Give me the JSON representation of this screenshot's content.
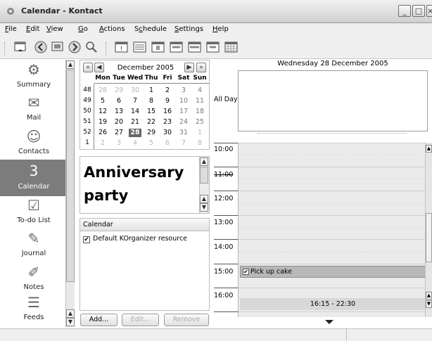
{
  "window": {
    "title": "Calendar - Kontact",
    "controls": [
      "_",
      "□",
      "×"
    ]
  },
  "menu": [
    {
      "pre": "",
      "u": "F",
      "post": "ile"
    },
    {
      "pre": "",
      "u": "E",
      "post": "dit"
    },
    {
      "pre": "",
      "u": "V",
      "post": "iew"
    },
    {
      "pre": "",
      "u": "G",
      "post": "o"
    },
    {
      "pre": "",
      "u": "A",
      "post": "ctions"
    },
    {
      "pre": "S",
      "u": "c",
      "post": "hedule"
    },
    {
      "pre": "",
      "u": "S",
      "post": "ettings"
    },
    {
      "pre": "",
      "u": "H",
      "post": "elp"
    }
  ],
  "toolbar": {
    "icons": [
      "new-icon",
      "back-icon",
      "forward-icon",
      "goto-icon",
      "find-icon",
      "today-icon",
      "list-icon",
      "day-icon",
      "workweek-icon",
      "week-icon",
      "nextdays-icon",
      "month-icon"
    ]
  },
  "sidebar": {
    "items": [
      {
        "label": "Summary",
        "icon": "summary-icon",
        "glyph": "⚙"
      },
      {
        "label": "Mail",
        "icon": "mail-icon",
        "glyph": "✉"
      },
      {
        "label": "Contacts",
        "icon": "contacts-icon",
        "glyph": "☺"
      },
      {
        "label": "Calendar",
        "icon": "calendar-icon",
        "glyph": "3",
        "selected": true
      },
      {
        "label": "To-do List",
        "icon": "todo-icon",
        "glyph": "☑"
      },
      {
        "label": "Journal",
        "icon": "journal-icon",
        "glyph": "✎"
      },
      {
        "label": "Notes",
        "icon": "notes-icon",
        "glyph": "✐"
      },
      {
        "label": "Feeds",
        "icon": "feeds-icon",
        "glyph": "☰"
      }
    ]
  },
  "navigator": {
    "month": "December 2005",
    "day_headers": [
      "Mon",
      "Tue",
      "Wed",
      "Thu",
      "Fri",
      "Sat",
      "Sun"
    ],
    "weeks": [
      {
        "wn": "48",
        "days": [
          [
            "28",
            "other"
          ],
          [
            "29",
            "other"
          ],
          [
            "30",
            "other"
          ],
          [
            "1",
            ""
          ],
          [
            "2",
            ""
          ],
          [
            "3",
            "wk"
          ],
          [
            "4",
            "wk"
          ]
        ]
      },
      {
        "wn": "49",
        "days": [
          [
            "5",
            ""
          ],
          [
            "6",
            ""
          ],
          [
            "7",
            ""
          ],
          [
            "8",
            ""
          ],
          [
            "9",
            ""
          ],
          [
            "10",
            "wk"
          ],
          [
            "11",
            "wk"
          ]
        ]
      },
      {
        "wn": "50",
        "days": [
          [
            "12",
            ""
          ],
          [
            "13",
            ""
          ],
          [
            "14",
            ""
          ],
          [
            "15",
            ""
          ],
          [
            "16",
            ""
          ],
          [
            "17",
            "wk"
          ],
          [
            "18",
            "wk"
          ]
        ]
      },
      {
        "wn": "51",
        "days": [
          [
            "19",
            ""
          ],
          [
            "20",
            ""
          ],
          [
            "21",
            ""
          ],
          [
            "22",
            ""
          ],
          [
            "23",
            ""
          ],
          [
            "24",
            "wk"
          ],
          [
            "25",
            "wk"
          ]
        ]
      },
      {
        "wn": "52",
        "days": [
          [
            "26",
            ""
          ],
          [
            "27",
            ""
          ],
          [
            "28",
            "today"
          ],
          [
            "29",
            ""
          ],
          [
            "30",
            ""
          ],
          [
            "31",
            "wk"
          ],
          [
            "1",
            "other"
          ]
        ]
      },
      {
        "wn": "1",
        "days": [
          [
            "2",
            "other"
          ],
          [
            "3",
            "other"
          ],
          [
            "4",
            "other"
          ],
          [
            "5",
            "other"
          ],
          [
            "6",
            "other"
          ],
          [
            "7",
            "other"
          ],
          [
            "8",
            "other"
          ]
        ]
      }
    ]
  },
  "event_view": {
    "title": "Anniversary party"
  },
  "resources": {
    "header": "Calendar",
    "item": "Default KOrganizer resource",
    "checked": "✔"
  },
  "buttons": {
    "add": "Add...",
    "edit": "Edit...",
    "remove": "Remove"
  },
  "agenda": {
    "date_header": "Wednesday 28 December 2005",
    "all_day_label": "All Day",
    "times": [
      "10:00",
      "11:00",
      "12:00",
      "13:00",
      "14:00",
      "15:00",
      "16:00"
    ],
    "events": [
      {
        "label": "Pick up cake"
      },
      {
        "label": "16:15 - 22:30"
      }
    ]
  }
}
